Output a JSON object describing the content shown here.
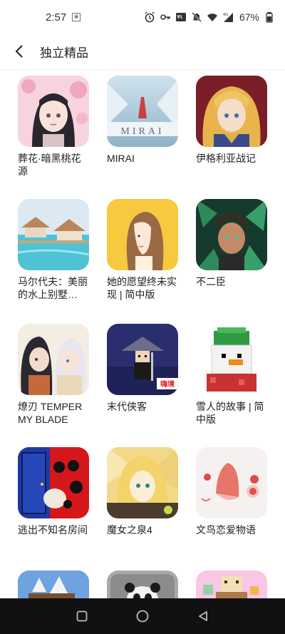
{
  "status_bar": {
    "time": "2:57",
    "left_icon": "image-icon",
    "right_icons": [
      "alarm-icon",
      "key-icon",
      "volte-icon",
      "mute-icon",
      "wifi-icon",
      "signal-4g-icon"
    ],
    "network_label": "4G",
    "battery_percent": "67%"
  },
  "header": {
    "title": "独立精品",
    "back_icon": "chevron-left-icon"
  },
  "apps": [
    {
      "name": "葬花·暗黑桃花源",
      "icon": "anime-girl-sakura-art"
    },
    {
      "name": "MIRAI",
      "icon": "mirai-art"
    },
    {
      "name": "伊格利亚战记",
      "icon": "blonde-knight-art"
    },
    {
      "name": "马尔代夫：美丽的水上别墅…",
      "icon": "maldives-villa-art"
    },
    {
      "name": "她的愿望终未实现 | 简中版",
      "icon": "girl-profile-art"
    },
    {
      "name": "不二臣",
      "icon": "green-leaves-man-art"
    },
    {
      "name": "燎刃 TEMPER MY BLADE",
      "icon": "two-swordsmen-art"
    },
    {
      "name": "末代侠客",
      "icon": "pixel-swordsman-art"
    },
    {
      "name": "雪人的故事 | 简中版",
      "icon": "pixel-snowman-art"
    },
    {
      "name": "逃出不知名房间",
      "icon": "door-room-art"
    },
    {
      "name": "魔女之泉4",
      "icon": "witch-art"
    },
    {
      "name": "文鸟恋爱物语",
      "icon": "bird-art"
    },
    {
      "name": "",
      "icon": "ship-art"
    },
    {
      "name": "",
      "icon": "panda-art"
    },
    {
      "name": "",
      "icon": "pixel-food-art"
    }
  ],
  "embedded_text": {
    "mirai_logo": "MIRAI",
    "pixel_badge": "嗨境"
  },
  "navbar": {
    "buttons": [
      "recents-square-icon",
      "home-circle-icon",
      "back-triangle-icon"
    ]
  },
  "colors": {
    "background": "#ffffff",
    "navbar": "#111111",
    "text": "#222222"
  }
}
